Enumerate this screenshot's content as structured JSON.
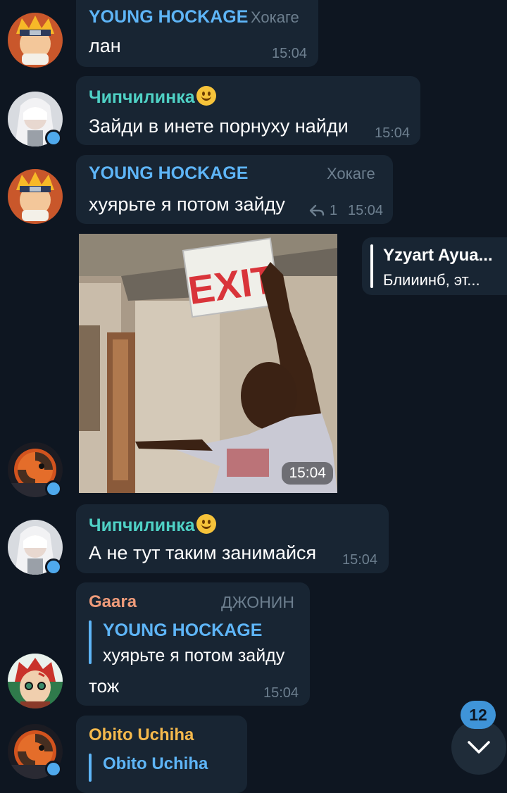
{
  "colors": {
    "background": "#0e1621",
    "bubble": "#182533",
    "young_hockage_name": "#5eb5f7",
    "chipchilinka_name": "#4fd1c5",
    "gaara_name": "#ee9b7a",
    "obito_name": "#f5b94c",
    "meta_text": "#6d7f8f",
    "online_dot": "#4fa9ec"
  },
  "messages": [
    {
      "sender": "YOUNG HOCKAGE",
      "rank": "Хокаге",
      "text": "лан",
      "time": "15:04"
    },
    {
      "sender": "Чипчилинка",
      "text": "Зайди в инете порнуху найди",
      "time": "15:04"
    },
    {
      "sender": "YOUNG HOCKAGE",
      "rank": "Хокаге",
      "text": "хуярьте я потом зайду",
      "replies": "1",
      "time": "15:04"
    },
    {
      "photo_text": "EXIT",
      "time": "15:04",
      "reply_preview": {
        "name": "Yzyart Ayua...",
        "text": "Блииинб, эт..."
      }
    },
    {
      "sender": "Чипчилинка",
      "text": "А не тут таким занимайся",
      "time": "15:04"
    },
    {
      "sender": "Gaara",
      "rank": "ДЖОНИН",
      "quote": {
        "name": "YOUNG HOCKAGE",
        "text": "хуярьте я потом зайду"
      },
      "text": "тож",
      "time": "15:04"
    },
    {
      "sender": "Obito Uchiha",
      "quote": {
        "name": "Obito Uchiha"
      }
    }
  ],
  "scroll_button": {
    "unread_count": "12",
    "icon": "chevron-down-icon"
  }
}
